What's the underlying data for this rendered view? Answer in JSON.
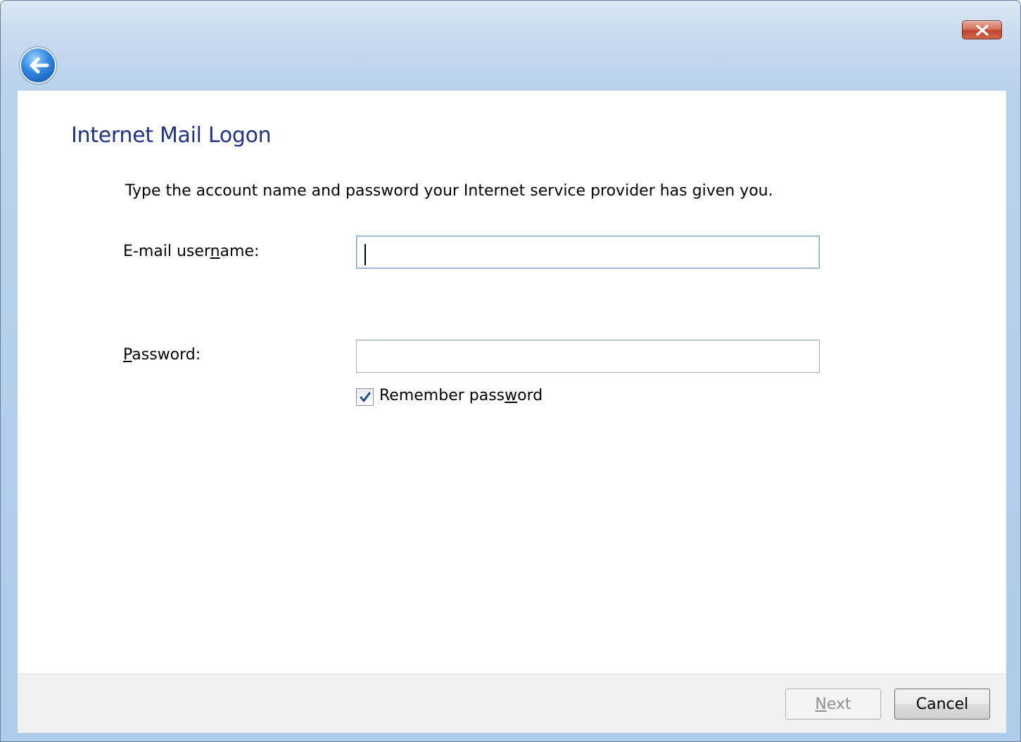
{
  "dialog": {
    "title": "Internet Mail Logon",
    "instruction": "Type the account name and password your Internet service provider has given you."
  },
  "form": {
    "username_label_pre": "E-mail user",
    "username_label_mnemonic": "n",
    "username_label_post": "ame:",
    "username_value": "",
    "password_label_mnemonic": "P",
    "password_label_post": "assword:",
    "password_value": "",
    "remember_label_pre": "Remember pass",
    "remember_label_mnemonic": "w",
    "remember_label_post": "ord",
    "remember_checked": true
  },
  "buttons": {
    "next_mnemonic": "N",
    "next_rest": "ext",
    "next_enabled": false,
    "cancel": "Cancel"
  },
  "icons": {
    "close": "close-icon",
    "back": "back-arrow-icon",
    "check": "checkmark-icon"
  },
  "colors": {
    "title": "#1e3287",
    "close_button": "#c4452c",
    "back_button": "#2f86e0"
  }
}
